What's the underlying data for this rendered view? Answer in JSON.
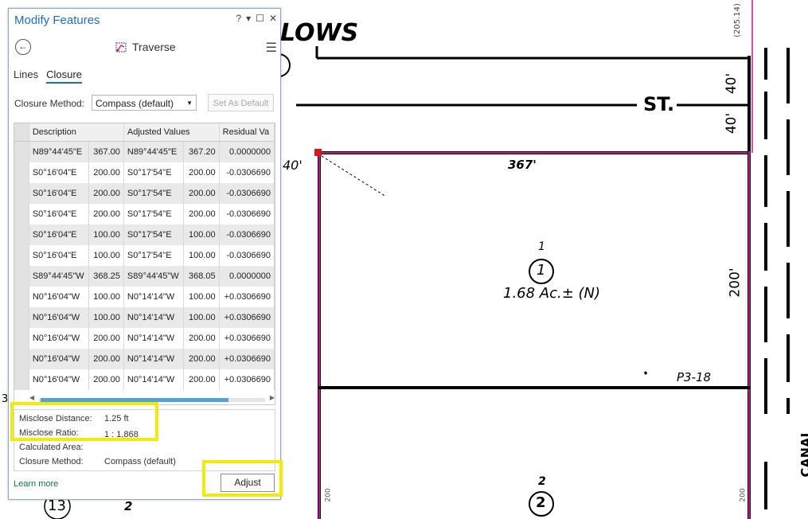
{
  "pane": {
    "title": "Modify Features",
    "help_label": "?",
    "tool_name": "Traverse",
    "tabs": [
      {
        "label": "Lines"
      },
      {
        "label": "Closure"
      }
    ],
    "closure_method_label": "Closure Method:",
    "closure_method_value": "Compass (default)",
    "set_default_label": "Set As Default",
    "grid": {
      "headers": [
        "Description",
        "Adjusted Values",
        "Residual Va"
      ],
      "rows": [
        {
          "bearing": "N89°44'45\"E",
          "dist": "367.00",
          "adj_bearing": "N89°44'45\"E",
          "adj_dist": "367.20",
          "residual": "0.0000000"
        },
        {
          "bearing": "S0°16'04\"E",
          "dist": "200.00",
          "adj_bearing": "S0°17'54\"E",
          "adj_dist": "200.00",
          "residual": "-0.0306690"
        },
        {
          "bearing": "S0°16'04\"E",
          "dist": "200.00",
          "adj_bearing": "S0°17'54\"E",
          "adj_dist": "200.00",
          "residual": "-0.0306690"
        },
        {
          "bearing": "S0°16'04\"E",
          "dist": "200.00",
          "adj_bearing": "S0°17'54\"E",
          "adj_dist": "200.00",
          "residual": "-0.0306690"
        },
        {
          "bearing": "S0°16'04\"E",
          "dist": "100.00",
          "adj_bearing": "S0°17'54\"E",
          "adj_dist": "100.00",
          "residual": "-0.0306690"
        },
        {
          "bearing": "S0°16'04\"E",
          "dist": "100.00",
          "adj_bearing": "S0°17'54\"E",
          "adj_dist": "100.00",
          "residual": "-0.0306690"
        },
        {
          "bearing": "S89°44'45\"W",
          "dist": "368.25",
          "adj_bearing": "S89°44'45\"W",
          "adj_dist": "368.05",
          "residual": "0.0000000"
        },
        {
          "bearing": "N0°16'04\"W",
          "dist": "100.00",
          "adj_bearing": "N0°14'14\"W",
          "adj_dist": "100.00",
          "residual": "+0.0306690"
        },
        {
          "bearing": "N0°16'04\"W",
          "dist": "100.00",
          "adj_bearing": "N0°14'14\"W",
          "adj_dist": "100.00",
          "residual": "+0.0306690"
        },
        {
          "bearing": "N0°16'04\"W",
          "dist": "200.00",
          "adj_bearing": "N0°14'14\"W",
          "adj_dist": "200.00",
          "residual": "+0.0306690"
        },
        {
          "bearing": "N0°16'04\"W",
          "dist": "200.00",
          "adj_bearing": "N0°14'14\"W",
          "adj_dist": "200.00",
          "residual": "+0.0306690"
        },
        {
          "bearing": "N0°16'04\"W",
          "dist": "200.00",
          "adj_bearing": "N0°14'14\"W",
          "adj_dist": "200.00",
          "residual": "+0.0306690"
        }
      ]
    },
    "summary": {
      "misclose_distance_label": "Misclose Distance:",
      "misclose_distance_value": "1.25 ft",
      "misclose_ratio_label": "Misclose Ratio:",
      "misclose_ratio_value": "1 : 1,868",
      "area_label": "Calculated Area:",
      "method_label": "Closure Method:",
      "method_value": "Compass (default)"
    },
    "learn_more": "Learn more",
    "adjust_label": "Adjust"
  },
  "map": {
    "street_top": "LOWS",
    "street_st": "ST.",
    "dim_40_left": "40'",
    "dim_367": "367'",
    "dim_200_right": "200'",
    "dim_40_right_a": "40'",
    "dim_40_right_b": "40'",
    "lot_number": "1",
    "lot_circle": "1",
    "lot_area": "1.68 Ac.± (N)",
    "p3_label": "P3-18",
    "lot2_number": "2",
    "lot2_circle": "2",
    "lot13": "13",
    "lot_2_bottom": "2",
    "side_205": "(205.14)",
    "canal": "CANAL",
    "small_200_left": "200",
    "small_200_right": "200",
    "left_3": "3"
  },
  "colors": {
    "accent": "#1f6fb8",
    "highlight": "#f2ea08",
    "parcel_line": "#c2188e",
    "scroll_thumb": "#4ea3de"
  }
}
